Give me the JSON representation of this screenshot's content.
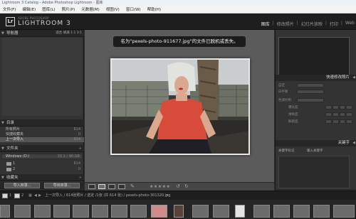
{
  "window_title": "Lightroom 3 Catalog - Adobe Photoshop Lightroom - 图库",
  "menu": [
    "文件(F)",
    "编辑(E)",
    "图库(L)",
    "照片(P)",
    "元数据(M)",
    "视图(V)",
    "窗口(W)",
    "帮助(H)"
  ],
  "brand": {
    "small": "ADOBE PHOTOSHOP",
    "large": "LIGHTROOM 3",
    "logo": "Lr"
  },
  "modules": [
    {
      "label": "图库",
      "active": true
    },
    {
      "label": "修改照片",
      "active": false
    },
    {
      "label": "幻灯片放映",
      "active": false
    },
    {
      "label": "打印",
      "active": false
    },
    {
      "label": "Web",
      "active": false
    }
  ],
  "left": {
    "navigator": {
      "title": "导航器",
      "fit": "适合",
      "fill": "填满",
      "one_to_one": "1:1",
      "ratio": "3:1"
    },
    "catalog": {
      "title": "目录",
      "rows": [
        {
          "label": "所有照片",
          "count": "614"
        },
        {
          "label": "快捷收藏夹",
          "count": "0"
        },
        {
          "label": "上一次导入",
          "count": "614",
          "selected": true
        }
      ]
    },
    "folders": {
      "title": "文件夹",
      "volume": {
        "label": "Windows (D:)",
        "count": "33.1 / 90 GB"
      },
      "rows": [
        {
          "label": "1",
          "count": "614"
        },
        {
          "label": "2",
          "count": "0"
        }
      ]
    },
    "collections": {
      "title": "收藏夹"
    },
    "import_button": "导入目录...",
    "export_button": "导出目录..."
  },
  "center": {
    "toast": "名为\"pexels-photo-911677.jpg\"的文件已脱机或丢失。",
    "stars": "★★★★★"
  },
  "right": {
    "quick_develop": {
      "title": "快速修改照片",
      "rows": [
        {
          "label": "自定"
        },
        {
          "label": "白平衡"
        },
        {
          "label": "色调控制"
        },
        {
          "label": "曝光度"
        },
        {
          "label": "清晰度"
        },
        {
          "label": "鲜艳度"
        }
      ]
    },
    "keywording": {
      "title": "关键字",
      "left_label": "关键字标记",
      "right_label": "输入关键字"
    }
  },
  "filmstrip": {
    "page1": "1",
    "page2": "2",
    "path_text": "上一次导入 / 614张照片 / 选定 /1张 (共 614 张) / pexels-photo-301320.jpg"
  }
}
